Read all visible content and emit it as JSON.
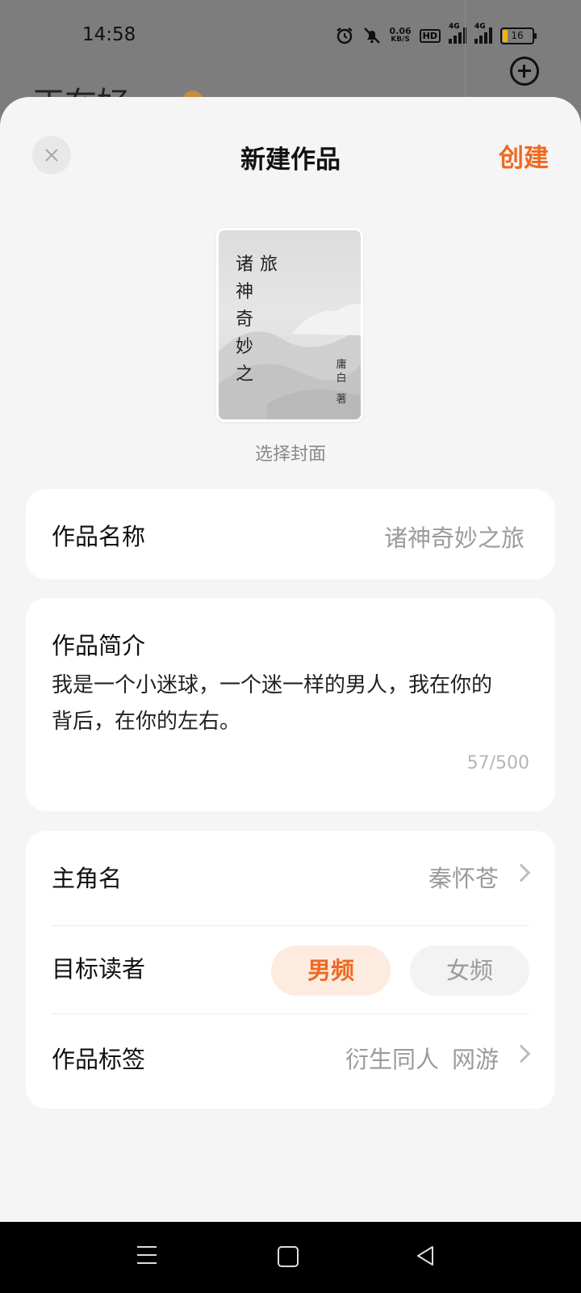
{
  "status_bar": {
    "time": "14:58",
    "speed_value": "0.06",
    "speed_unit": "KB/S",
    "hd_label": "HD",
    "network_label": "4G",
    "battery_level": "16",
    "icons": [
      "alarm-icon",
      "mute-icon",
      "hd-icon",
      "signal-icon",
      "signal-icon",
      "battery-icon"
    ]
  },
  "background": {
    "title_partial": "正在好",
    "add_icon": "plus-circle-icon"
  },
  "sheet": {
    "title": "新建作品",
    "create_label": "创建",
    "close_icon": "close-icon",
    "accent_color": "#ee6a22"
  },
  "cover": {
    "title_col1": "诸神奇妙之",
    "title_col2": "旅",
    "author": "庸白",
    "author_suffix": "著",
    "label": "选择封面"
  },
  "form": {
    "name_label": "作品名称",
    "name_value": "诸神奇妙之旅",
    "intro_label": "作品简介",
    "intro_text": "我是一个小迷球，一个迷一样的男人，我在你的背后，在你的左右。",
    "intro_counter": "57/500",
    "protagonist_label": "主角名",
    "protagonist_value": "秦怀苍",
    "reader_label": "目标读者",
    "reader_options": [
      "男频",
      "女频"
    ],
    "reader_selected": "男频",
    "tags_label": "作品标签",
    "tags": [
      "衍生同人",
      "网游"
    ]
  },
  "nav": {
    "icons": [
      "menu-icon",
      "home-icon",
      "back-icon"
    ]
  }
}
